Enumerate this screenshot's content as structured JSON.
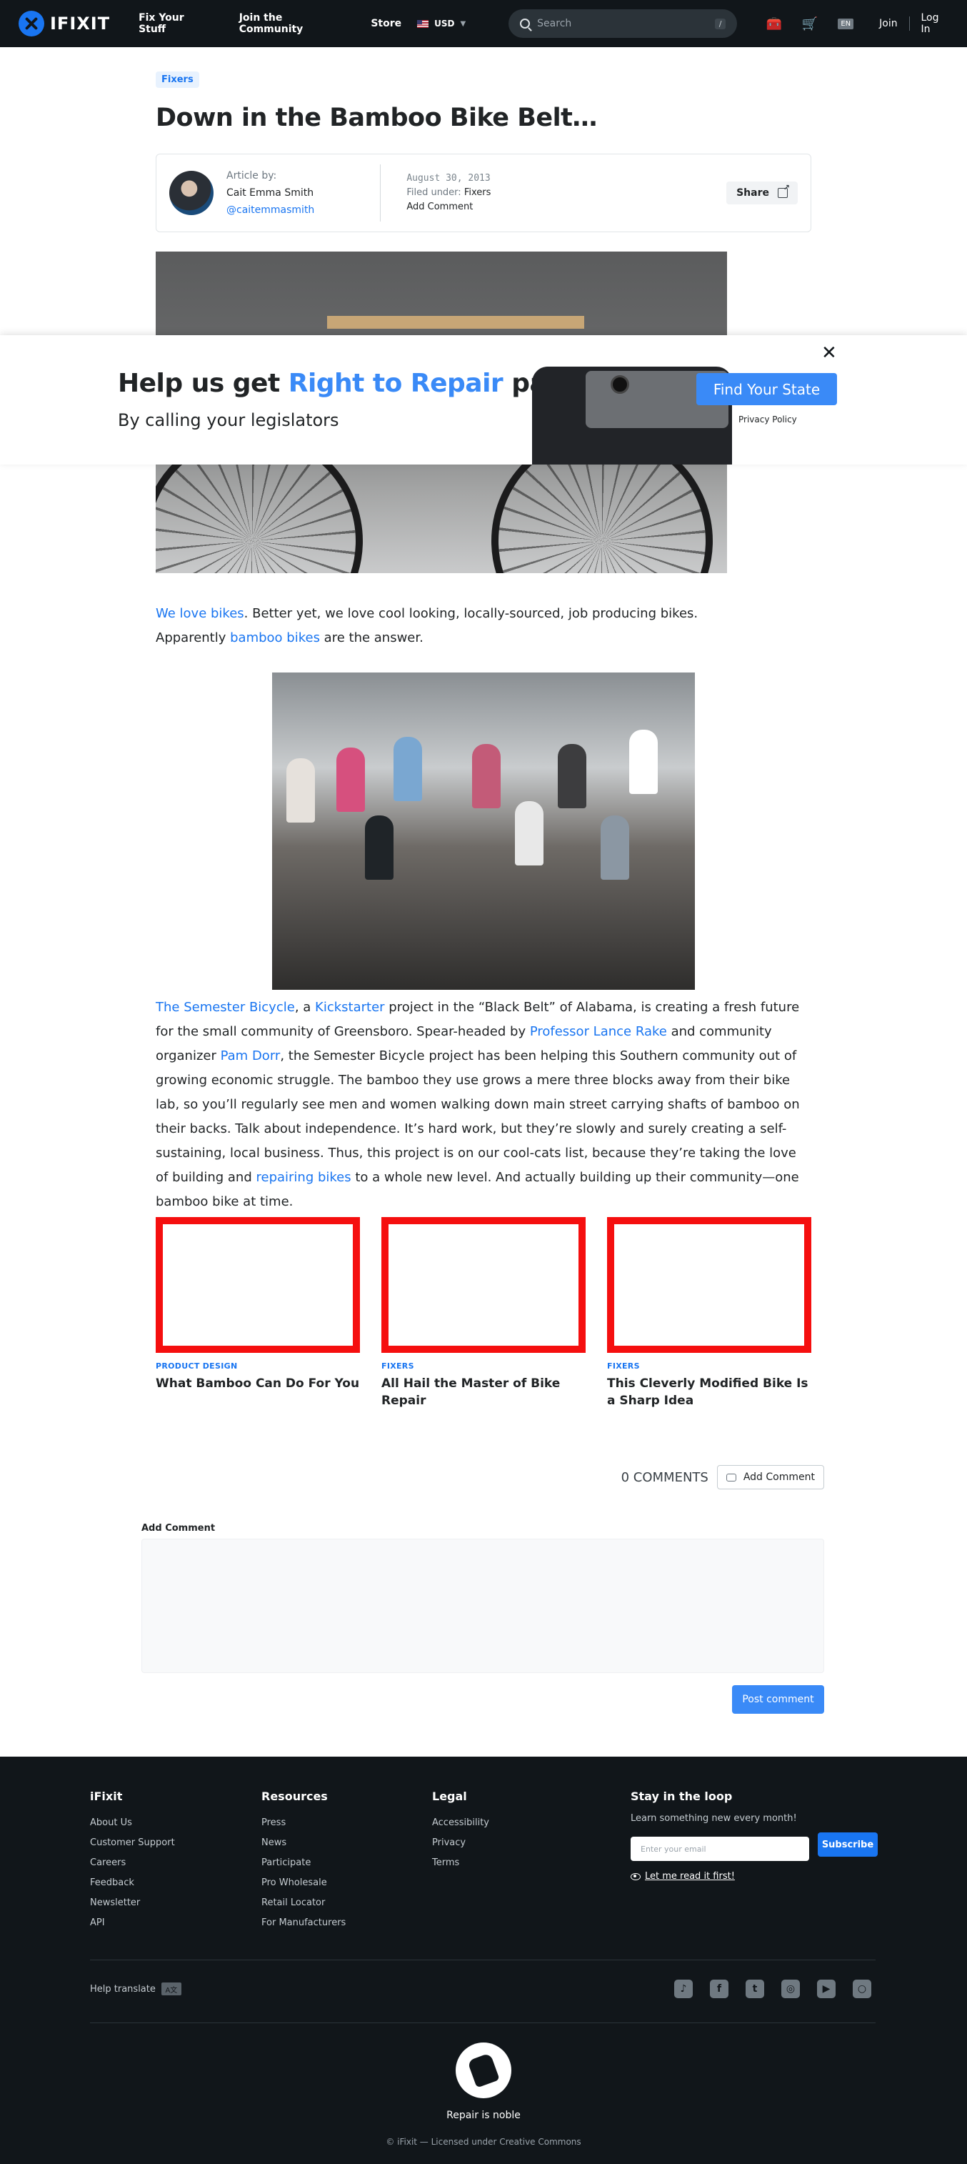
{
  "nav": {
    "logo": "IFIXIT",
    "links": [
      "Fix Your Stuff",
      "Join the Community",
      "Store"
    ],
    "currency": "USD",
    "search_placeholder": "Search",
    "search_shortcut": "/",
    "language": "EN",
    "join": "Join",
    "login": "Log In"
  },
  "article": {
    "category": "Fixers",
    "title": "Down in the Bamboo Bike Belt…",
    "author_label": "Article by:",
    "author_name": "Cait Emma Smith",
    "author_handle": "@caitemmasmith",
    "date": "August 30, 2013",
    "filed_label": "Filed under:",
    "filed_value": "Fixers",
    "add_comment": "Add Comment",
    "share": "Share",
    "p1": {
      "link1": "We love bikes",
      "t1": ". Better yet, we love cool looking, locally-sourced, job producing bikes. Apparently ",
      "link2": "bamboo bikes",
      "t2": " are the answer."
    },
    "p2": {
      "link1": "The Semester Bicycle",
      "t1": ", a ",
      "link2": "Kickstarter",
      "t2": " project in the “Black Belt” of Alabama, is creating a fresh future for the small community of Greensboro.  Spear-headed by ",
      "link3": "Professor Lance Rake",
      "t3": " and community organizer ",
      "link4": "Pam Dorr",
      "t4": ", the Semester Bicycle project has been helping this Southern community out of growing economic struggle. The bamboo they use grows a mere three blocks away from their bike lab, so you’ll regularly see men and women walking down main street carrying shafts of bamboo on their backs. Talk about independence. It’s hard work, but they’re slowly and surely creating a self-sustaining, local business. Thus, this project is on our cool-cats list, because they’re taking the love of building and ",
      "link5": "repairing bikes",
      "t5": " to a whole new level. And actually building up their community—one bamboo bike at time."
    }
  },
  "related": [
    {
      "category": "PRODUCT DESIGN",
      "title": "What Bamboo Can Do For You"
    },
    {
      "category": "FIXERS",
      "title": "All Hail the Master of Bike Repair"
    },
    {
      "category": "FIXERS",
      "title": "This Cleverly Modified Bike Is a Sharp Idea"
    }
  ],
  "comments": {
    "count": "0 COMMENTS",
    "add_button": "Add Comment",
    "label": "Add Comment",
    "post_button": "Post comment"
  },
  "banner": {
    "title_pre": "Help us get ",
    "title_highlight": "Right to Repair",
    "title_post": " passed",
    "subtitle": "By calling your legislators",
    "cta": "Find Your State",
    "privacy": "Privacy Policy",
    "close": "✕"
  },
  "footer": {
    "col1": {
      "title": "iFixit",
      "items": [
        "About Us",
        "Customer Support",
        "Careers",
        "Feedback",
        "Newsletter",
        "API"
      ]
    },
    "col2": {
      "title": "Resources",
      "items": [
        "Press",
        "News",
        "Participate",
        "Pro Wholesale",
        "Retail Locator",
        "For Manufacturers"
      ]
    },
    "col3": {
      "title": "Legal",
      "items": [
        "Accessibility",
        "Privacy",
        "Terms"
      ]
    },
    "loop": {
      "title": "Stay in the loop",
      "subtitle": "Learn something new every month!",
      "placeholder": "Enter your email",
      "button": "Subscribe",
      "read": "Let me read it first!"
    },
    "help_translate": "Help translate",
    "tagline": "Repair is noble",
    "copyright": "© iFixit — Licensed under Creative Commons"
  },
  "colors": {
    "brand_blue": "#1975f1",
    "nav_bg": "#11161a",
    "placeholder_red": "#f50f0f"
  }
}
